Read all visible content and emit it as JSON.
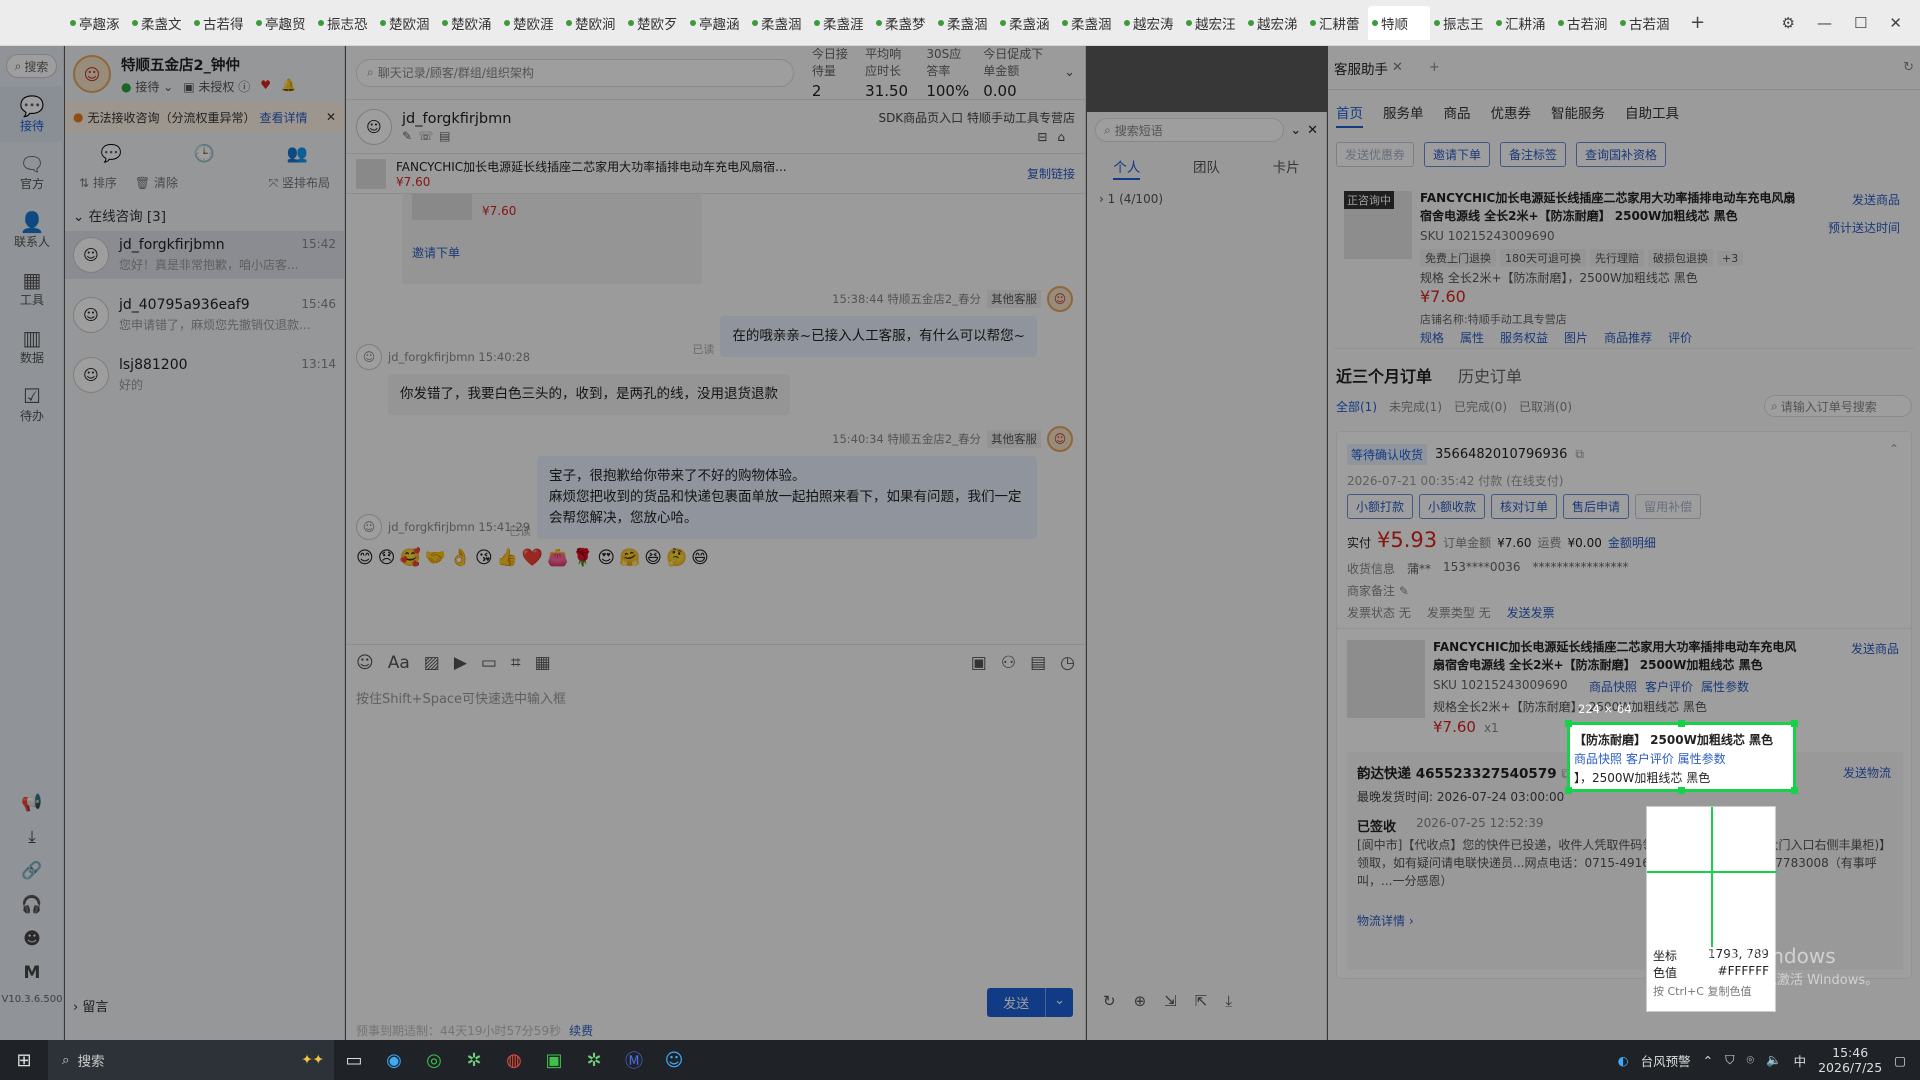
{
  "tabs": [
    "亭趣涿",
    "柔盏文",
    "古若得",
    "亭趣贸",
    "振志恐",
    "楚欧涸",
    "楚欧涌",
    "楚欧涯",
    "楚欧涧",
    "楚欧歹",
    "亭趣涵",
    "柔盏涸",
    "柔盏涯",
    "柔盏梦",
    "柔盏涸",
    "柔盏涵",
    "柔盏涸",
    "越宏涛",
    "越宏汪",
    "越宏涕",
    "汇耕蕾",
    "特顺",
    "振志王",
    "汇耕涌",
    "古若涧",
    "古若涸"
  ],
  "active_tab": "特顺",
  "plus": "+",
  "version": "V10.3.6.500",
  "nav": {
    "search": "搜索",
    "items": [
      {
        "label": "接待",
        "icon": "chat-icon"
      },
      {
        "label": "官方",
        "icon": "message-icon"
      },
      {
        "label": "联系人",
        "icon": "contacts-icon"
      },
      {
        "label": "工具",
        "icon": "grid-icon"
      },
      {
        "label": "数据",
        "icon": "chart-icon"
      },
      {
        "label": "待办",
        "icon": "todo-icon"
      }
    ]
  },
  "store": {
    "name": "特顺五金店2_钟仲",
    "status_reception": "接待",
    "status_auth": "未授权"
  },
  "warning": {
    "text": "无法接收咨询（分流权重异常）",
    "link": "查看详情"
  },
  "list_tools": {
    "sort": "排序",
    "clear": "清除",
    "layout": "竖排布局"
  },
  "online_header": "在线咨询 [3]",
  "conversations": [
    {
      "name": "jd_forgkfirjbmn",
      "time": "15:42",
      "preview": "您好！真是非常抱歉，咱小店客..."
    },
    {
      "name": "jd_40795a936eaf9",
      "time": "15:46",
      "preview": "您申请错了，麻烦您先撤销仅退款..."
    },
    {
      "name": "lsj881200",
      "time": "13:14",
      "preview": "好的"
    }
  ],
  "leave_msg": "留言",
  "chat": {
    "search_placeholder": "聊天记录/顾客/群组/组织架构",
    "stats": [
      {
        "label": "今日接待量",
        "value": "2"
      },
      {
        "label": "平均响应时长",
        "value": "31.50"
      },
      {
        "label": "30S应答率",
        "value": "100%"
      },
      {
        "label": "今日促成下单金额",
        "value": "0.00"
      }
    ],
    "customer": "jd_forgkfirjbmn",
    "header_links": "SDK商品页入口  特顺手动工具专营店",
    "product_title": "FANCYCHIC加长电源延长线插座二芯家用大功率插排电动车充电风扇宿...",
    "product_price": "¥7.60",
    "copy_link": "复制链接",
    "invite_order": "邀请下单",
    "messages": [
      {
        "side": "right",
        "meta": "15:38:44  特顺五金店2_春分",
        "tag": "其他客服",
        "text": "在的哦亲亲~已接入人工客服，有什么可以帮您~",
        "read": "已读"
      },
      {
        "side": "left",
        "meta": "jd_forgkfirjbmn  15:40:28",
        "text": "你发错了，我要白色三头的，收到，是两孔的线，没用退货退款"
      },
      {
        "side": "right",
        "meta": "15:40:34  特顺五金店2_春分",
        "tag": "其他客服",
        "text": "宝子，很抱歉给你带来了不好的购物体验。\n麻烦您把收到的货品和快递包裹面单放一起拍照来看下，如果有问题，我们一定会帮您解决，您放心哈。",
        "read": "已读"
      },
      {
        "side": "left",
        "meta": "jd_forgkfirjbmn  15:41:29",
        "text": ""
      }
    ],
    "emojis": "😊😞🥰🤝👌😘👍❤️👛🌹😍🤗😆🤔😄",
    "input_placeholder": "按住Shift+Space可快速选中输入框",
    "send": "发送",
    "notice": "预事到期适制：44天19小时57分59秒",
    "notice_link": "续费"
  },
  "quick": {
    "search_placeholder": "搜索短语",
    "tabs": [
      "个人",
      "团队",
      "卡片"
    ],
    "group": "1 (4/100)"
  },
  "assistant": {
    "title": "客服助手",
    "tabs": [
      "首页",
      "服务单",
      "商品",
      "优惠券",
      "智能服务",
      "自助工具"
    ],
    "actions": [
      {
        "label": "发送优惠券",
        "disabled": true
      },
      {
        "label": "邀请下单",
        "disabled": false
      },
      {
        "label": "备注标签",
        "disabled": false
      },
      {
        "label": "查询国补资格",
        "disabled": false
      }
    ],
    "product": {
      "badge": "正咨询中",
      "title": "FANCYCHIC加长电源延长线插座二芯家用大功率插排电动车充电风扇宿舍电源线 全长2米+【防冻耐磨】 2500W加粗线芯 黑色",
      "sku": "SKU 10215243009690",
      "tags": [
        "免费上门退换",
        "180天可退可换",
        "先行理赔",
        "破损包退换",
        "+3"
      ],
      "spec": "规格 全长2米+【防冻耐磨】，2500W加粗线芯 黑色",
      "price": "¥7.60",
      "shop": "店铺名称:特顺手动工具专营店",
      "links": [
        "规格",
        "属性",
        "服务权益",
        "图片",
        "商品推荐",
        "评价"
      ],
      "send": "发送商品",
      "eta": "预计送达时间"
    },
    "orders_title": "近三个月订单",
    "history_title": "历史订单",
    "order_filters": [
      "全部(1)",
      "未完成(1)",
      "已完成(0)",
      "已取消(0)"
    ],
    "order_search_placeholder": "请输入订单号搜索",
    "order": {
      "status": "等待确认收货",
      "id": "3566482010796936",
      "time": "2026-07-21 00:35:42 付款 (在线支付)",
      "buttons": [
        "小额打款",
        "小额收款",
        "核对订单",
        "售后申请",
        "留用补偿"
      ],
      "paid_label": "实付",
      "paid": "¥5.93",
      "total_label": "订单金额",
      "total": "¥7.60",
      "shipping_label": "运费",
      "shipping": "¥0.00",
      "detail_link": "金额明细",
      "receiver_label": "收货信息",
      "receiver": "蒲**",
      "phone": "153****0036",
      "address": "****************",
      "note_label": "商家备注",
      "ship_status": "发票状态  无",
      "ship_type": "发票类型  无",
      "invoice_link": "发送发票",
      "item_title": "FANCYCHIC加长电源延长线插座二芯家用大功率插排电动车充电风扇宿舍电源线 全长2米+【防冻耐磨】 2500W加粗线芯 黑色",
      "item_sku": "SKU 10215243009690",
      "item_links": [
        "商品快照",
        "客户评价",
        "属性参数"
      ],
      "item_spec": "规格全长2米+【防冻耐磨】，2500W加粗线芯 黑色",
      "item_price": "¥7.60",
      "item_qty": "x1",
      "item_send": "发送商品",
      "express": "韵达快递 465523327540579",
      "express_send": "发送物流",
      "latest_time": "最晚发货时间:  2026-07-24 03:00:00",
      "signed": "已签收",
      "signed_time": "2026-07-25 12:52:39",
      "track": "[阆中市]【代收点】您的快件已投递，收件人凭取件码领取...丰巢柜(飞宇小区大门入口右侧丰巢柜)】领取，如有疑问请电联快递员...网点电话：0715-4916546，投诉电话：15527783008（有事呼叫，...一分感恩）",
      "track_link": "物流详情"
    }
  },
  "picker": {
    "size": "224 × 64",
    "coord_label": "坐标",
    "coord": "1793, 789",
    "color_label": "色值",
    "color": "#FFFFFF",
    "hint": "按 Ctrl+C 复制色值"
  },
  "watermark": "激活 Windows",
  "watermark_sub": "转到\"设置\"以激活 Windows。",
  "taskbar": {
    "search": "搜索",
    "weather": "台风预警",
    "time": "15:46",
    "date": "2026/7/25",
    "ime": "中"
  },
  "colors": {
    "accent": "#1e5fd8",
    "select": "#17d14a",
    "price": "#d9251c"
  }
}
